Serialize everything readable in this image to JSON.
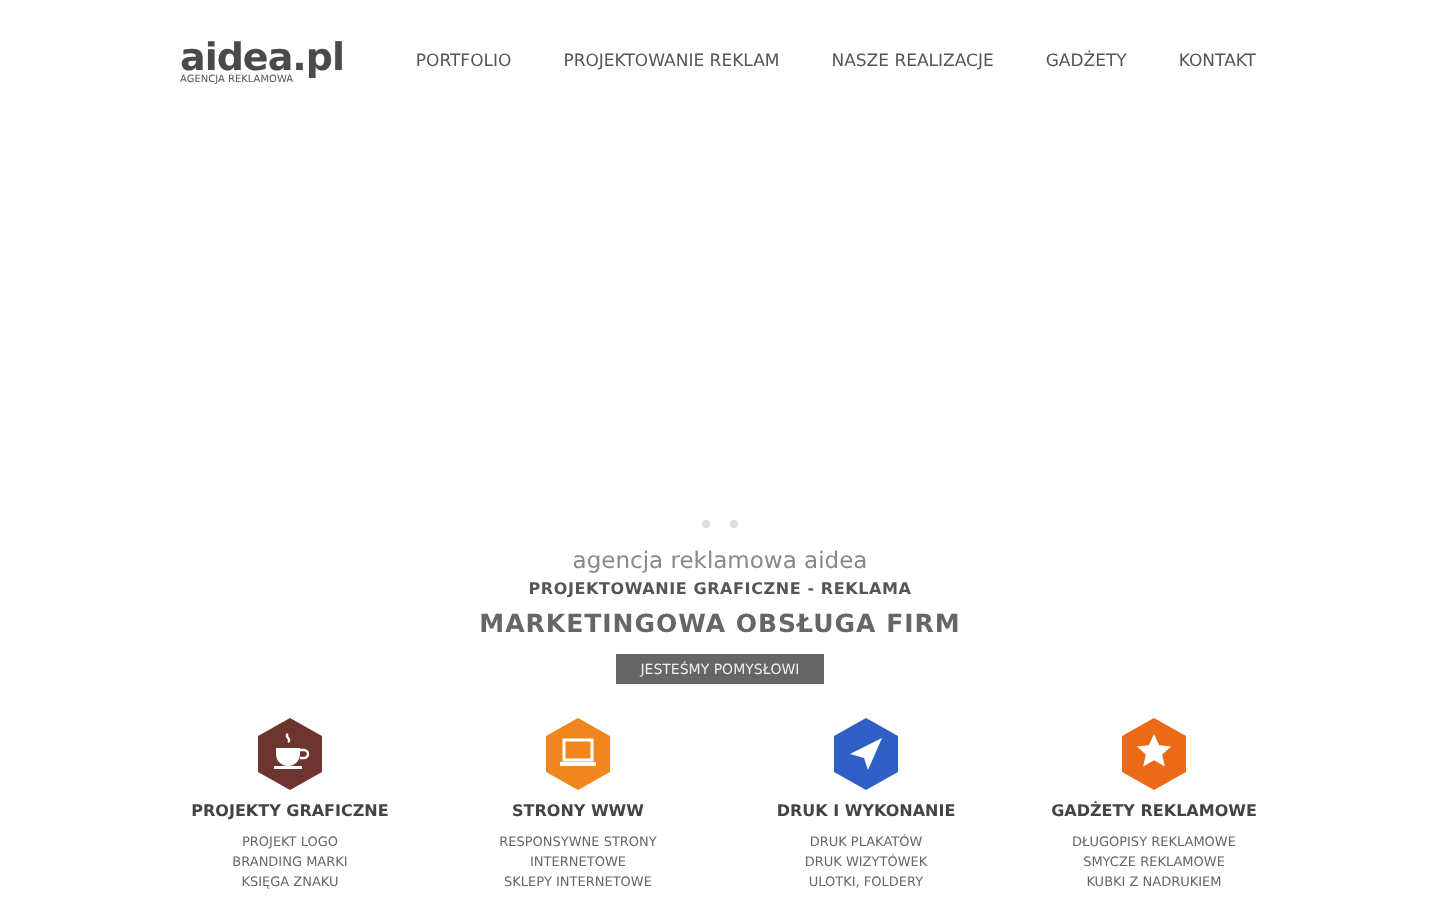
{
  "logo": {
    "name": "aidea.pl",
    "tagline": "AGENCJA REKLAMOWA"
  },
  "nav": [
    "PORTFOLIO",
    "PROJEKTOWANIE REKLAM",
    "NASZE REALIZACJE",
    "GADŻETY",
    "KONTAKT"
  ],
  "slider": {
    "dots": [
      {
        "selected": false
      },
      {
        "selected": false
      }
    ]
  },
  "hero": {
    "intro": "agencja reklamowa aidea",
    "subtitle": "PROJEKTOWANIE GRAFICZNE - REKLAMA",
    "headline": "MARKETINGOWA OBSŁUGA FIRM",
    "button": "JESTEŚMY POMYSŁOWI"
  },
  "services": [
    {
      "kind": "cup",
      "color": "#6e3530",
      "title": "PROJEKTY GRAFICZNE",
      "lines": [
        "PROJEKT LOGO",
        "BRANDING MARKI",
        "KSIĘGA ZNAKU"
      ]
    },
    {
      "kind": "laptop",
      "color": "#f0871e",
      "title": "STRONY WWW",
      "lines": [
        "RESPONSYWNE STRONY",
        "INTERNETOWE",
        "SKLEPY INTERNETOWE"
      ]
    },
    {
      "kind": "plane",
      "color": "#2f5fc4",
      "title": "DRUK I WYKONANIE",
      "lines": [
        "DRUK PLAKATÓW",
        "DRUK WIZYTÓWEK",
        "ULOTKI, FOLDERY"
      ]
    },
    {
      "kind": "star",
      "color": "#ec6a16",
      "title": "GADŻETY REKLAMOWE",
      "lines": [
        "DŁUGOPISY REKLAMOWE",
        "SMYCZE REKLAMOWE",
        "KUBKI Z NADRUKIEM"
      ]
    }
  ]
}
